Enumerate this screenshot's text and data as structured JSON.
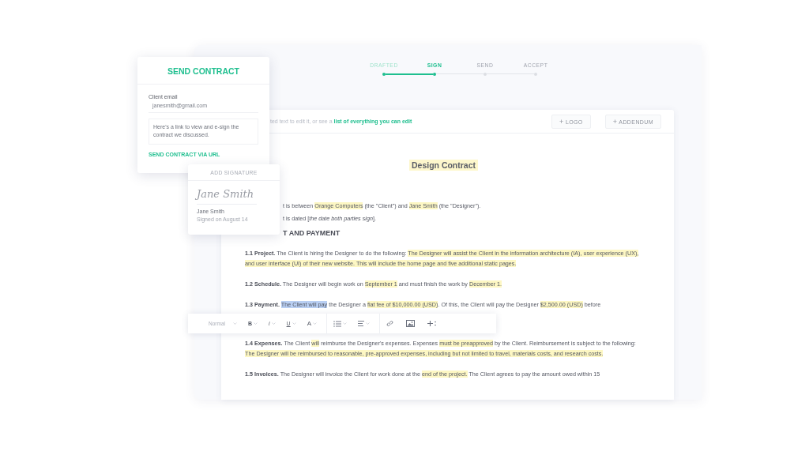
{
  "steps": [
    {
      "label": "DRAFTED",
      "done": true,
      "selected": false
    },
    {
      "label": "SIGN",
      "done": false,
      "selected": true
    },
    {
      "label": "SEND",
      "done": false,
      "selected": false
    },
    {
      "label": "ACCEPT",
      "done": false,
      "selected": false
    }
  ],
  "hint_bar": {
    "text": "ted text to edit it, or see a",
    "link": "list of everything you can edit",
    "buttons": [
      {
        "icon": "+",
        "label": "LOGO"
      },
      {
        "icon": "+",
        "label": "ADDENDUM"
      }
    ]
  },
  "document": {
    "title": "Design Contract",
    "paragraphs": [
      {
        "kind": "intro",
        "segments": [
          {
            "kind": "plain",
            "text": "t is between "
          },
          {
            "kind": "field",
            "text": "Orange Computers"
          },
          {
            "kind": "plain",
            "text": " (the \"Client\") and "
          },
          {
            "kind": "field",
            "text": "Jane Smith"
          },
          {
            "kind": "plain",
            "text": " (the \"Designer\")."
          }
        ]
      },
      {
        "kind": "intro",
        "segments": [
          {
            "kind": "plain",
            "text": "t is dated [*the date both parties sign*]."
          }
        ]
      },
      {
        "kind": "heading",
        "segments": [
          {
            "kind": "plain",
            "text": "T AND PAYMENT"
          }
        ]
      },
      {
        "kind": "clause",
        "lead": "1.1 Project.",
        "segments": [
          {
            "kind": "plain",
            "text": "The Client is hiring the Designer to do the following: "
          },
          {
            "kind": "field",
            "text": "The Designer will assist the Client in the information architecture (IA), user experience (UX), and user interface (UI) of their new website. This will include the home page and five additional static pages."
          }
        ]
      },
      {
        "kind": "clause",
        "lead": "1.2 Schedule.",
        "segments": [
          {
            "kind": "plain",
            "text": "The Designer will begin work on "
          },
          {
            "kind": "field",
            "text": "September 1"
          },
          {
            "kind": "plain",
            "text": " and must finish the work by "
          },
          {
            "kind": "field",
            "text": "December 1."
          }
        ]
      },
      {
        "kind": "clause",
        "lead": "1.3 Payment.",
        "segments": [
          {
            "kind": "selected",
            "text": "The Client will pay"
          },
          {
            "kind": "plain",
            "text": " the Designer a "
          },
          {
            "kind": "field",
            "text": "flat fee of $10,000.00 (USD)"
          },
          {
            "kind": "plain",
            "text": ". Of this, the Client will pay the Designer "
          },
          {
            "kind": "field",
            "text": "$2,500.00 (USD)"
          },
          {
            "kind": "plain",
            "text": " before"
          }
        ]
      },
      {
        "kind": "toolbar"
      },
      {
        "kind": "clause",
        "lead": "1.4 Expenses.",
        "segments": [
          {
            "kind": "plain",
            "text": "The Client "
          },
          {
            "kind": "field",
            "text": "will"
          },
          {
            "kind": "plain",
            "text": " reimburse the Designer's expenses. Expenses "
          },
          {
            "kind": "field",
            "text": "must be preapproved"
          },
          {
            "kind": "plain",
            "text": " by the Client. Reimbursement is subject to the following: "
          },
          {
            "kind": "field",
            "text": "The Designer will be reimbursed to reasonable, pre-approved expenses, including but not limited to travel, materials costs, and research costs."
          }
        ]
      },
      {
        "kind": "clause",
        "lead": "1.5 Invoices.",
        "segments": [
          {
            "kind": "plain",
            "text": "The Designer will invoice the Client for work done at the "
          },
          {
            "kind": "field",
            "text": "end of the project."
          },
          {
            "kind": "plain",
            "text": " The Client agrees to pay the amount owed within 15"
          }
        ]
      }
    ]
  },
  "format_toolbar": [
    {
      "kind": "style",
      "label": "Normal"
    },
    {
      "kind": "bold",
      "label": "B"
    },
    {
      "kind": "italic",
      "label": "i"
    },
    {
      "kind": "underline",
      "label": "U"
    },
    {
      "kind": "size",
      "label": "A"
    },
    {
      "kind": "list"
    },
    {
      "kind": "align"
    },
    {
      "kind": "link"
    },
    {
      "kind": "image"
    },
    {
      "kind": "insert"
    }
  ],
  "send_contract": {
    "title": "SEND CONTRACT",
    "email_label": "Client email",
    "email": "janesmith@gmail.com",
    "message": "Here's a link to view and e-sign the contract we discussed.",
    "action": "SEND CONTRACT VIA URL"
  },
  "signature_card": {
    "title": "ADD SIGNATURE",
    "signature": "Jane Smith",
    "name": "Jane Smith",
    "date": "Signed on August 14"
  }
}
